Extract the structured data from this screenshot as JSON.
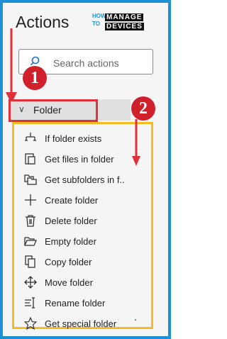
{
  "header": {
    "title": "Actions"
  },
  "logo": {
    "line1": "HOW",
    "line2": "TO",
    "word1": "MANAGE",
    "word2": "DEVICES"
  },
  "search": {
    "placeholder": "Search actions"
  },
  "badges": {
    "one": "1",
    "two": "2"
  },
  "folder_group": {
    "label": "Folder",
    "expanded": true
  },
  "folder_actions": [
    {
      "label": "If folder exists",
      "icon": "branch-icon"
    },
    {
      "label": "Get files in folder",
      "icon": "files-icon"
    },
    {
      "label": "Get subfolders in f..",
      "icon": "subfolders-icon"
    },
    {
      "label": "Create folder",
      "icon": "plus-icon"
    },
    {
      "label": "Delete folder",
      "icon": "trash-icon"
    },
    {
      "label": "Empty folder",
      "icon": "open-folder-icon"
    },
    {
      "label": "Copy folder",
      "icon": "copy-icon"
    },
    {
      "label": "Move folder",
      "icon": "move-icon"
    },
    {
      "label": "Rename folder",
      "icon": "rename-icon"
    },
    {
      "label": "Get special folder",
      "icon": "star-icon"
    }
  ],
  "colors": {
    "frame": "#1e90d6",
    "highlight_red": "#e0303a",
    "highlight_yellow": "#f6bb1e",
    "badge": "#d0202c"
  }
}
